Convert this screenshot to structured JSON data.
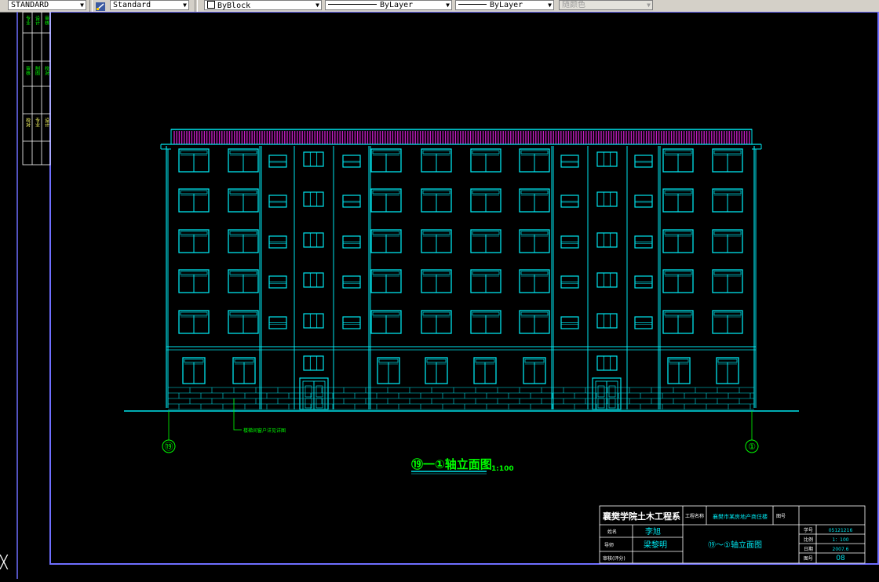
{
  "toolbar": {
    "text_style": "STANDARD",
    "dim_style": "Standard",
    "layer": "ByBlock",
    "linetype": "ByLayer",
    "lineweight": "ByLayer",
    "plot_style": "随颜色"
  },
  "drawing": {
    "title_main": "⑲一①轴立面图",
    "title_scale": "1:100",
    "axis_left": "⑲",
    "axis_right": "①",
    "leader_note": "楼梯间窗户详见详图",
    "revision_column": [
      "专业",
      "审核",
      "校对",
      "设计",
      "制图"
    ]
  },
  "title_block": {
    "school": "襄樊学院土木工程系",
    "project_label": "工程名称",
    "project_name": "襄樊市某房地产商住楼",
    "sheet_label": "图号",
    "drawing_name": "⑲～①轴立面图",
    "row1_label": "姓名",
    "row1_value": "李旭",
    "row2_label": "导师",
    "row2_value": "梁黎明",
    "row3_label": "审核(评分)",
    "info_labels": [
      "学号",
      "比例",
      "日期",
      "图号"
    ],
    "info_values": [
      "05121216",
      "1：100",
      "2007.6",
      "08"
    ]
  },
  "colors": {
    "background": "#000000",
    "building": "#00e5ee",
    "roof": "#c01cc0",
    "annotation": "#00ff00",
    "frame": "#6f6fff",
    "text": "#ffffff"
  },
  "cursor_glyph": "╳"
}
